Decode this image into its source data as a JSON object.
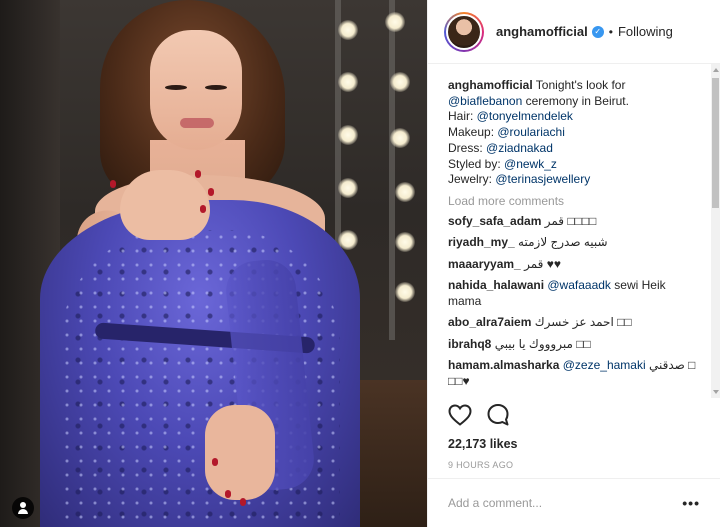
{
  "post": {
    "username": "anghamofficial",
    "follow_status": "Following",
    "separator": "•",
    "verified_glyph": "✓",
    "caption": {
      "username": "anghamofficial",
      "lines": [
        {
          "text": " Tonight's look for",
          "mention": ""
        },
        {
          "text": "",
          "mention": "@biaflebanon",
          "suffix": " ceremony in Beirut."
        },
        {
          "text": "Hair: ",
          "mention": "@tonyelmendelek"
        },
        {
          "text": "Makeup: ",
          "mention": "@roulariachi"
        },
        {
          "text": "Dress: ",
          "mention": "@ziadnakad"
        },
        {
          "text": "Styled by: ",
          "mention": "@newk_z"
        },
        {
          "text": "Jewelry: ",
          "mention": "@terinasjewellery"
        }
      ]
    },
    "load_more": "Load more comments",
    "comments": [
      {
        "user": "sofy_safa_adam",
        "text": " قمر □□□□",
        "mention": ""
      },
      {
        "user": "riyadh_my_",
        "text": " شبيه صدرج لازمته",
        "mention": ""
      },
      {
        "user": "maaaryyam_",
        "text": " قمر ♥♥",
        "mention": ""
      },
      {
        "user": "nahida_halawani",
        "text": " sewi Heik mama",
        "mention": "@wafaaadk"
      },
      {
        "user": "abo_alra7aiem",
        "text": " احمد عز خسرك □□",
        "mention": ""
      },
      {
        "user": "ibrahq8",
        "text": " مبروووك يا بيبي □□",
        "mention": ""
      },
      {
        "user": "hamam.almasharka",
        "text": " صدقني □ □□♥",
        "mention": "@zeze_hamaki"
      }
    ],
    "likes": "22,173 likes",
    "timestamp": "9 HOURS AGO",
    "add_comment_placeholder": "Add a comment...",
    "more_options": "•••",
    "icons": {
      "like": "heart-icon",
      "comment": "comment-icon",
      "user_tag": "user-tag-icon",
      "verified": "verified-badge-icon"
    },
    "colors": {
      "link": "#003569",
      "verified": "#3897f0",
      "muted": "#999999",
      "text": "#262626"
    }
  }
}
